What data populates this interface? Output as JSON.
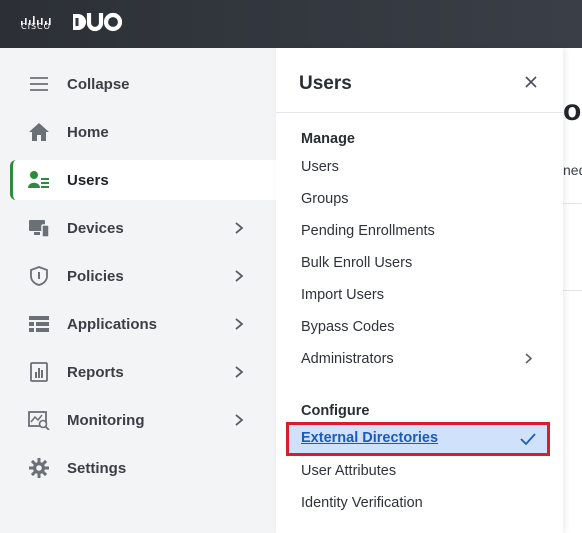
{
  "topbar": {
    "cisco_text": "CISCO",
    "brand": "DUO"
  },
  "sidebar": {
    "items": [
      {
        "label": "Collapse",
        "icon": "hamburger-icon"
      },
      {
        "label": "Home",
        "icon": "home-icon"
      },
      {
        "label": "Users",
        "icon": "users-icon",
        "active": true
      },
      {
        "label": "Devices",
        "icon": "devices-icon",
        "has_submenu": true
      },
      {
        "label": "Policies",
        "icon": "shield-icon",
        "has_submenu": true
      },
      {
        "label": "Applications",
        "icon": "applications-icon",
        "has_submenu": true
      },
      {
        "label": "Reports",
        "icon": "reports-icon",
        "has_submenu": true
      },
      {
        "label": "Monitoring",
        "icon": "monitoring-icon",
        "has_submenu": true
      },
      {
        "label": "Settings",
        "icon": "gear-icon"
      }
    ]
  },
  "panel": {
    "title": "Users",
    "manage": {
      "heading": "Manage",
      "items": [
        "Users",
        "Groups",
        "Pending Enrollments",
        "Bulk Enroll Users",
        "Import Users",
        "Bypass Codes",
        "Administrators"
      ]
    },
    "configure": {
      "heading": "Configure",
      "selected": "External Directories",
      "items": [
        "User Attributes",
        "Identity Verification"
      ]
    }
  },
  "background": {
    "heading": "ori",
    "sub": "ned"
  },
  "colors": {
    "active_accent": "#2e8b3d",
    "selected_bg": "#cfe1fb",
    "highlight_border": "#d4202a",
    "link_blue": "#1d5bb8"
  }
}
